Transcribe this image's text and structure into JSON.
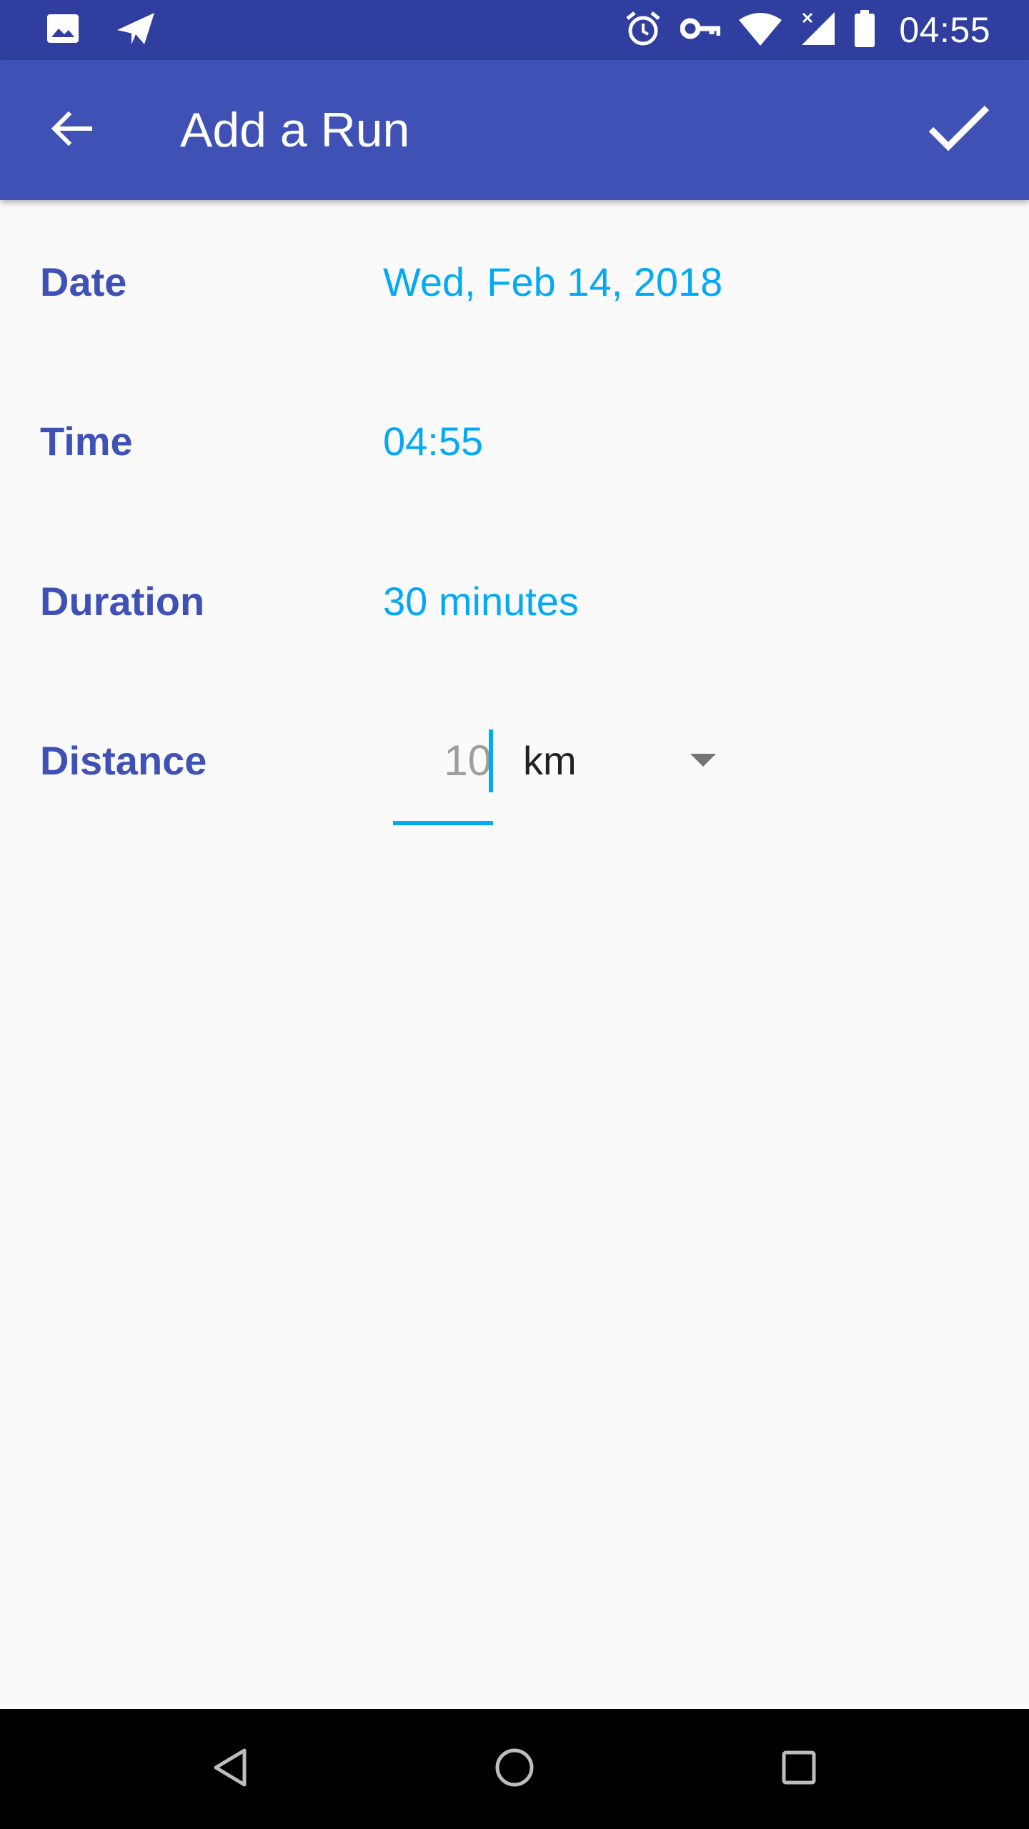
{
  "status_bar": {
    "time": "04:55",
    "icons": [
      "image-icon",
      "send-icon",
      "alarm-icon",
      "key-icon",
      "wifi-icon",
      "signal-off-icon",
      "battery-icon"
    ]
  },
  "toolbar": {
    "title": "Add a Run",
    "back_icon": "arrow-back-icon",
    "done_icon": "check-icon"
  },
  "form": {
    "date": {
      "label": "Date",
      "value": "Wed, Feb 14, 2018"
    },
    "time": {
      "label": "Time",
      "value": "04:55"
    },
    "duration": {
      "label": "Duration",
      "value": "30 minutes"
    },
    "distance": {
      "label": "Distance",
      "value": "10",
      "unit": "km"
    }
  },
  "navigation_bar": {
    "icons": [
      "nav-back-icon",
      "nav-home-icon",
      "nav-recents-icon"
    ]
  },
  "colors": {
    "status_bar": "#303f9f",
    "toolbar": "#3f51b5",
    "label": "#3f51b5",
    "value": "#03a9f4",
    "background": "#fafafa"
  }
}
